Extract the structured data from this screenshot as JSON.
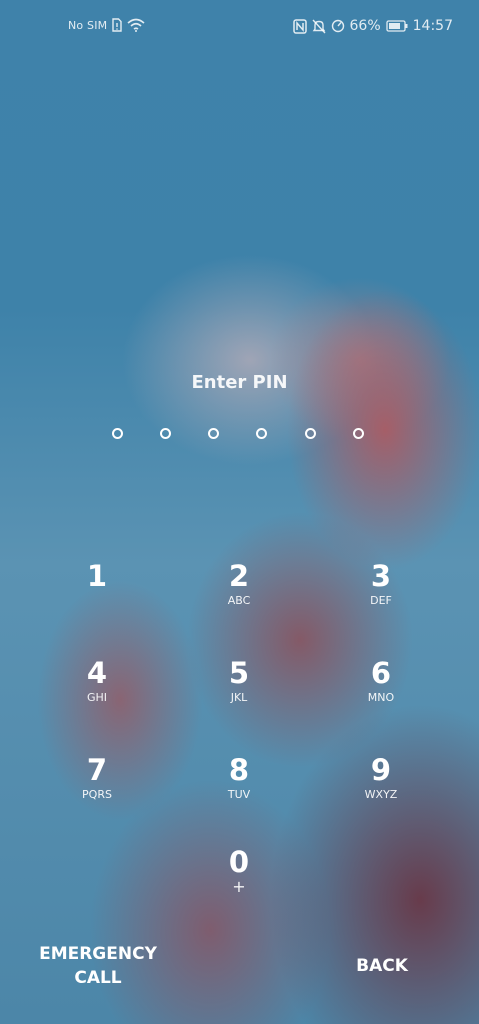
{
  "status_bar": {
    "carrier": "No SIM",
    "battery_percent": "66%",
    "time": "14:57",
    "icons": [
      "sim-card-icon",
      "wifi-icon",
      "nfc-icon",
      "mute-icon",
      "data-saver-icon",
      "battery-icon"
    ]
  },
  "lock_screen": {
    "prompt": "Enter PIN",
    "pin_length_dots": 6,
    "dot_color": "#ffffff"
  },
  "keypad": {
    "keys": [
      {
        "digit": "1",
        "letters": ""
      },
      {
        "digit": "2",
        "letters": "ABC"
      },
      {
        "digit": "3",
        "letters": "DEF"
      },
      {
        "digit": "4",
        "letters": "GHI"
      },
      {
        "digit": "5",
        "letters": "JKL"
      },
      {
        "digit": "6",
        "letters": "MNO"
      },
      {
        "digit": "7",
        "letters": "PQRS"
      },
      {
        "digit": "8",
        "letters": "TUV"
      },
      {
        "digit": "9",
        "letters": "WXYZ"
      },
      {
        "digit": "0",
        "letters": "+"
      }
    ]
  },
  "actions": {
    "emergency_call": "EMERGENCY CALL",
    "back": "BACK"
  }
}
